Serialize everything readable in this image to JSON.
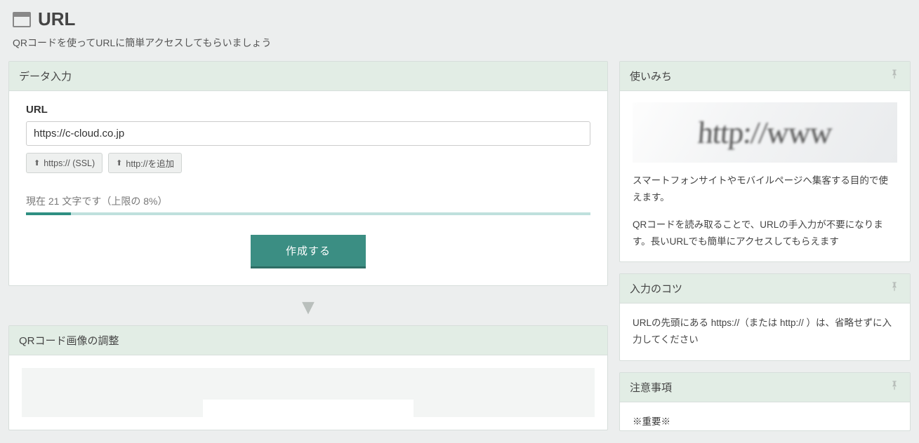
{
  "header": {
    "title": "URL",
    "subtitle": "QRコードを使ってURLに簡単アクセスしてもらいましょう"
  },
  "main": {
    "panel_input": {
      "title": "データ入力",
      "url_label": "URL",
      "url_value": "https://c-cloud.co.jp",
      "btn_https": "https:// (SSL)",
      "btn_http": "http://を追加",
      "counter": "現在 21 文字です（上限の 8%）",
      "progress_percent": 8,
      "submit": "作成する"
    },
    "panel_adjust": {
      "title": "QRコード画像の調整"
    }
  },
  "side": {
    "usage": {
      "title": "使いみち",
      "image_text": "http://www",
      "p1": "スマートフォンサイトやモバイルページへ集客する目的で使えます。",
      "p2": "QRコードを読み取ることで、URLの手入力が不要になります。長いURLでも簡単にアクセスしてもらえます"
    },
    "tips": {
      "title": "入力のコツ",
      "p1": "URLの先頭にある https://（または http:// ）は、省略せずに入力してください"
    },
    "caution": {
      "title": "注意事項",
      "p1": "※重要※"
    }
  }
}
